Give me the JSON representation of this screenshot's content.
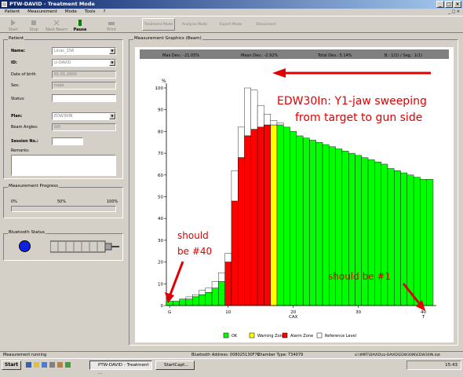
{
  "window": {
    "title": "PTW-DAVID - Treatment Mode"
  },
  "menu": [
    "Patient",
    "Measurement",
    "Mode",
    "Tools",
    "?"
  ],
  "toolbar": {
    "buttons": [
      "Start",
      "Stop",
      "Next Beam",
      "Pause",
      "Print"
    ],
    "modes": [
      "Treatment Mode",
      "Analysis Mode",
      "Expert Mode",
      "Disconnect"
    ]
  },
  "patient_panel": {
    "title": "Patient",
    "name_label": "Name:",
    "name_value": "Linac_156",
    "id_label": "ID:",
    "id_value": "iz-DAVID",
    "dob_label": "Date of birth",
    "dob_value": "01.01.2000",
    "sex_label": "Sex:",
    "sex_value": "male",
    "status_label": "Status:",
    "plan_label": "Plan:",
    "plan_value": "EDW30IN",
    "beam_angles_label": "Beam Angles:",
    "beam_angles_value": "0/0",
    "session_label": "Session No.:",
    "remarks_label": "Remarks:"
  },
  "progress_panel": {
    "title": "Measurement Progress",
    "ticks": [
      "0%",
      "50%",
      "100%"
    ]
  },
  "bluetooth_panel": {
    "title": "Bluetooth Status"
  },
  "graphics_panel": {
    "title": "Measurement Graphics (Beam)",
    "stats": [
      "Max Dev.: -21.05%",
      "Mean Dev.: -2.92%",
      "Total Dev.: 5.14%",
      "B.: 1(1) / Seg.: 1(1)"
    ]
  },
  "colors": {
    "ok": "#00ff00",
    "warning": "#ffff00",
    "alarm": "#ff0000",
    "reference": "#ffffff",
    "annotation": "#e00000"
  },
  "chart_data": {
    "type": "bar",
    "ylabel": "%",
    "y_ticks": [
      "0",
      "10",
      "20",
      "30",
      "40",
      "50",
      "60",
      "70",
      "80",
      "90",
      "100"
    ],
    "x_ticks": [
      "G",
      "10",
      "20",
      "30",
      "40"
    ],
    "x_sub_labels": [
      "CAX",
      "T"
    ],
    "ylim": [
      0,
      100
    ],
    "categories": [
      1,
      2,
      3,
      4,
      5,
      6,
      7,
      8,
      9,
      10,
      11,
      12,
      13,
      14,
      15,
      16,
      17,
      18,
      19,
      20,
      21,
      22,
      23,
      24,
      25,
      26,
      27,
      28,
      29,
      30,
      31,
      32,
      33,
      34,
      35,
      36,
      37,
      38,
      39,
      40
    ],
    "measured": [
      2,
      2,
      3,
      3,
      4,
      5,
      6,
      8,
      11,
      20,
      48,
      68,
      78,
      81,
      82,
      83,
      83,
      83,
      82,
      80,
      78,
      77,
      76,
      75,
      74,
      73,
      72,
      71,
      70,
      69,
      68,
      67,
      66,
      65,
      63,
      62,
      61,
      60,
      59,
      58,
      58
    ],
    "reference": [
      2,
      2,
      3,
      4,
      5,
      7,
      8,
      11,
      15,
      24,
      62,
      82,
      100,
      99,
      92,
      88,
      85,
      84,
      82,
      80,
      78,
      77,
      76,
      75,
      74,
      73,
      72,
      71,
      70,
      69,
      68,
      67,
      66,
      65,
      63,
      62,
      61,
      60,
      59,
      58,
      58
    ],
    "zones": [
      "ok",
      "ok",
      "ok",
      "ok",
      "ok",
      "ok",
      "ok",
      "ok",
      "ok",
      "alarm",
      "alarm",
      "alarm",
      "alarm",
      "alarm",
      "alarm",
      "alarm",
      "warning",
      "ok",
      "ok",
      "ok",
      "ok",
      "ok",
      "ok",
      "ok",
      "ok",
      "ok",
      "ok",
      "ok",
      "ok",
      "ok",
      "ok",
      "ok",
      "ok",
      "ok",
      "ok",
      "ok",
      "ok",
      "ok",
      "ok",
      "ok"
    ],
    "legend": [
      "OK",
      "Warning Zone",
      "Alarm Zone",
      "Reference Level"
    ],
    "annotations": {
      "main": [
        "EDW30In: Y1-jaw sweeping",
        "from target to gun side"
      ],
      "left": [
        "should",
        "be #40"
      ],
      "right": "should be #1"
    }
  },
  "statusbar": {
    "left": "Measurement running",
    "bluetooth": "Bluetooth Address: 008025130F79",
    "chamber": "Chamber Type: T34079",
    "file": "si:\\IMRT\\DAVID\\zz-DAVID\\EDW30IN\\EDW30IN.dat"
  },
  "taskbar": {
    "start": "Start",
    "tasks": [
      "PTW-DAVID - Treatment ...",
      "StartCapt..."
    ],
    "clock": "15:43"
  }
}
